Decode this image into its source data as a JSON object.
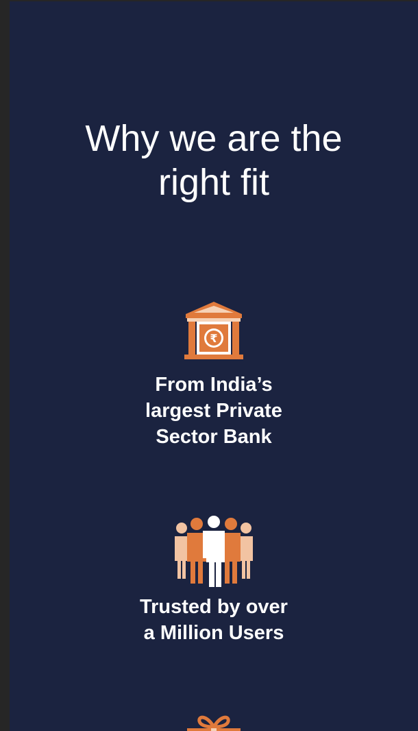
{
  "page": {
    "title_line1": "Why we are the",
    "title_line2": "right fit"
  },
  "features": [
    {
      "icon": "bank-rupee-icon",
      "lines": [
        "From India’s",
        "largest Private",
        "Sector Bank"
      ]
    },
    {
      "icon": "people-group-icon",
      "lines": [
        "Trusted by over",
        "a Million Users"
      ]
    },
    {
      "icon": "gift-icon",
      "lines": []
    }
  ],
  "colors": {
    "background": "#1b2340",
    "accent": "#e07a3c",
    "accent_light": "#f2c3a2",
    "text": "#ffffff"
  }
}
